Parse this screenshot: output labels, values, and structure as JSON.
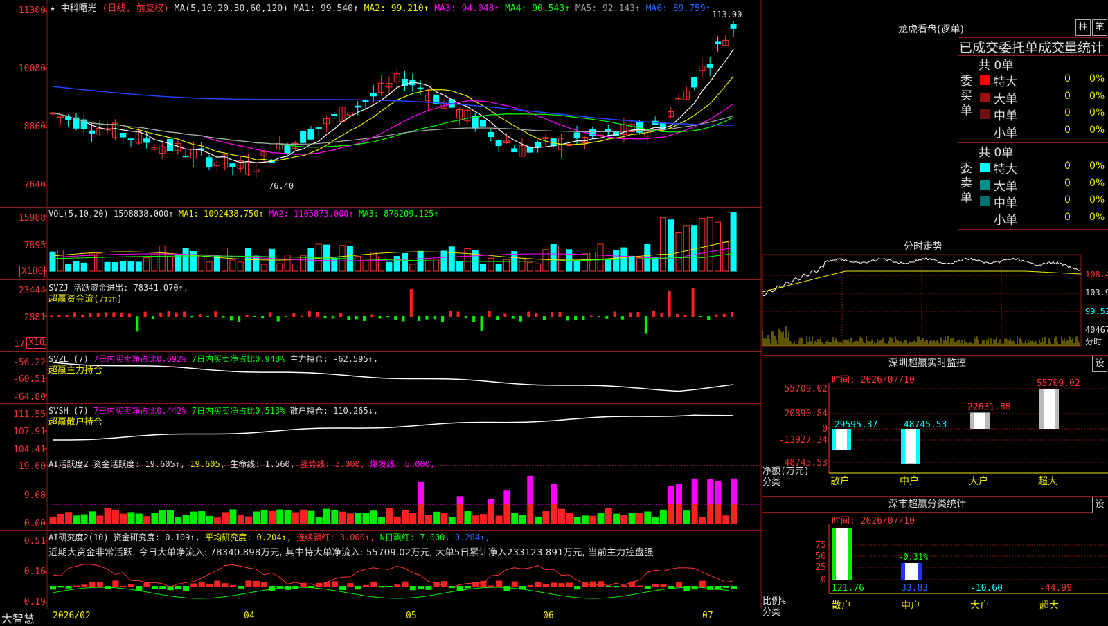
{
  "kline": {
    "star": "★",
    "name": "中科曙光",
    "period": "(日线, 前复权)",
    "ma_params": "MA(5,10,20,30,60,120)",
    "ma1": "MA1: 99.540↑",
    "ma2": "MA2: 99.210↑",
    "ma3": "MA3: 94.048↑",
    "ma4": "MA4: 90.543↑",
    "ma5": "MA5: 92.143↑",
    "ma6": "MA6: 89.759↑",
    "high_label": "113.00",
    "low_label": "76.40",
    "y_ticks": [
      "11300",
      "10080",
      "8860",
      "7640"
    ]
  },
  "vol": {
    "label": "VOL(5,10,20)",
    "value": "1598838.000↑",
    "ma1": "MA1: 1092438.750↑",
    "ma2": "MA2: 1105873.000↑",
    "ma3": "MA3: 878209.125↑",
    "y_ticks": [
      "15988",
      "7895"
    ],
    "unit": "X100"
  },
  "svzj": {
    "label": "SVZJ  活跃资金进出: 78341.070↑,",
    "sub": "超赢资金流(万元)",
    "y_ticks": [
      "23444",
      "2881",
      "-17"
    ],
    "unit": "X10"
  },
  "svzl": {
    "head": "SVZL (7)",
    "t1": "7日内买卖净占比0.692%",
    "t2": "7日内买卖净占比0.948%",
    "t3": "主力持仓: -62.595↑,",
    "sub": "超赢主力持仓",
    "y_ticks": [
      "-56.22",
      "-60.51",
      "-64.80"
    ]
  },
  "svsh": {
    "head": "SVSH (7)",
    "t1": "7日内买卖净占比0.442%",
    "t2": "7日内买卖净占比0.513%",
    "t3": "散户持仓: 110.265↓,",
    "sub": "超赢散户持仓",
    "y_ticks": [
      "111.55",
      "107.91",
      "104.41"
    ]
  },
  "ai1": {
    "head": "AI活跃度2 资金活跃度: 19.605↑,",
    "v2": "19.605,",
    "v3": "生命线: 1.560,",
    "v4": "强势线: 3.000,",
    "v5": "爆发线: 6.000,",
    "y_ticks": [
      "19.60",
      "9.68",
      "0.00"
    ]
  },
  "ai2": {
    "head": "AI研究度2(10) 资金研究度: 0.109↑,",
    "v2": "平均研究度: 0.204↑,",
    "v3": "连续飘红: 3.000↑,",
    "v4": "N日飘红: 7.000,",
    "v5": "0.204↑,",
    "desc": "近期大资金非常活跃, 今日大单净流入: 78340.898万元, 其中特大单净流入: 55709.02万元, 大单5日累计净入233123.891万元, 当前主力控盘强",
    "y_ticks": [
      "0.51",
      "0.16",
      "-0.19"
    ]
  },
  "xaxis": {
    "logo": "大智慧",
    "labels": [
      "2026/02",
      "04",
      "05",
      "06",
      "07"
    ]
  },
  "lhb": {
    "title": "龙虎看盘(逐单)",
    "btn1": "柱",
    "btn2": "笔",
    "subtitle": "已成交委托单成交量统计",
    "buy_side": "委买单",
    "sell_side": "委卖单",
    "buy_total": "共 0单",
    "sell_total": "共 0单",
    "buy_rows": [
      {
        "name": "特大",
        "val": "0",
        "pct": "0%",
        "color": "#ff0000"
      },
      {
        "name": "大单",
        "val": "0",
        "pct": "0%",
        "color": "#a01010"
      },
      {
        "name": "中单",
        "val": "0",
        "pct": "0%",
        "color": "#701010"
      },
      {
        "name": "小单",
        "val": "0",
        "pct": "0%",
        "color": "#000000"
      }
    ],
    "sell_rows": [
      {
        "name": "特大",
        "val": "0",
        "pct": "0%",
        "color": "#00ffff"
      },
      {
        "name": "大单",
        "val": "0",
        "pct": "0%",
        "color": "#009090"
      },
      {
        "name": "中单",
        "val": "0",
        "pct": "0%",
        "color": "#007070"
      },
      {
        "name": "小单",
        "val": "0",
        "pct": "0%",
        "color": "#000000"
      }
    ]
  },
  "fenshi": {
    "title": "分时走势",
    "y_ticks": [
      "108.4",
      "103.9",
      "99.52",
      "40467",
      "分时"
    ]
  },
  "sz_monitor": {
    "title": "深圳超赢实时监控",
    "btn": "设",
    "time": "时间: 2026/07/10",
    "y_ticks": [
      "55709.02",
      "20890.84",
      "0",
      "-13927.34",
      "-48745.53"
    ],
    "axis_label": "净额(万元)",
    "axis_label2": "分类",
    "cats": [
      "散户",
      "中户",
      "大户",
      "超大"
    ],
    "values": [
      "-29595.37",
      "-48745.53",
      "22631.88",
      "55709.02"
    ]
  },
  "sz_stats": {
    "title": "深市超赢分类统计",
    "btn": "设",
    "time": "时间: 2026/07/10",
    "y_ticks": [
      "75",
      "50",
      "25",
      "0"
    ],
    "axis_label": "比例%",
    "axis_label2": "分类",
    "zhonghu_pct": "-0.31%",
    "cats": [
      "散户",
      "中户",
      "大户",
      "超大"
    ],
    "values": [
      "121.76",
      "33.83",
      "-10.60",
      "-44.99"
    ]
  }
}
